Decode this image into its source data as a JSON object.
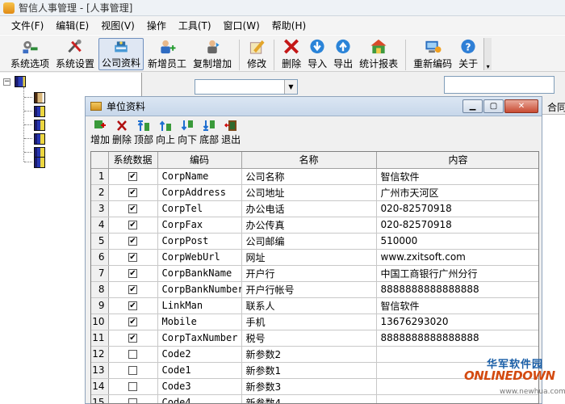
{
  "window": {
    "title": "智信人事管理 - [人事管理]"
  },
  "menu": [
    "文件(F)",
    "编辑(E)",
    "视图(V)",
    "操作",
    "工具(T)",
    "窗口(W)",
    "帮助(H)"
  ],
  "toolbar": [
    {
      "label": "系统选项",
      "icon": "options-icon"
    },
    {
      "label": "系统设置",
      "icon": "settings-icon"
    },
    {
      "label": "公司资料",
      "icon": "company-icon"
    },
    {
      "label": "新增员工",
      "icon": "add-employee-icon"
    },
    {
      "label": "复制增加",
      "icon": "copy-add-icon"
    },
    {
      "label": "修改",
      "icon": "edit-icon"
    },
    {
      "label": "删除",
      "icon": "delete-icon"
    },
    {
      "label": "导入",
      "icon": "import-icon"
    },
    {
      "label": "导出",
      "icon": "export-icon"
    },
    {
      "label": "统计报表",
      "icon": "report-icon"
    },
    {
      "label": "重新编码",
      "icon": "recode-icon"
    },
    {
      "label": "关于",
      "icon": "about-icon"
    }
  ],
  "right_panel": {
    "header": "合同"
  },
  "dialog": {
    "title": "单位资料",
    "toolbar": [
      {
        "label": "增加",
        "icon": "add-icon"
      },
      {
        "label": "删除",
        "icon": "delete-icon"
      },
      {
        "label": "顶部",
        "icon": "top-icon"
      },
      {
        "label": "向上",
        "icon": "up-icon"
      },
      {
        "label": "向下",
        "icon": "down-icon"
      },
      {
        "label": "底部",
        "icon": "bottom-icon"
      },
      {
        "label": "退出",
        "icon": "exit-icon"
      }
    ],
    "columns": [
      "系统数据",
      "编码",
      "名称",
      "内容"
    ],
    "rows": [
      {
        "n": "1",
        "sys": true,
        "code": "CorpName",
        "name": "公司名称",
        "content": "智信软件"
      },
      {
        "n": "2",
        "sys": true,
        "code": "CorpAddress",
        "name": "公司地址",
        "content": "广州市天河区"
      },
      {
        "n": "3",
        "sys": true,
        "code": "CorpTel",
        "name": "办公电话",
        "content": "020-82570918"
      },
      {
        "n": "4",
        "sys": true,
        "code": "CorpFax",
        "name": "办公传真",
        "content": "020-82570918"
      },
      {
        "n": "5",
        "sys": true,
        "code": "CorpPost",
        "name": "公司邮编",
        "content": "510000"
      },
      {
        "n": "6",
        "sys": true,
        "code": "CorpWebUrl",
        "name": "网址",
        "content": "www.zxitsoft.com"
      },
      {
        "n": "7",
        "sys": true,
        "code": "CorpBankName",
        "name": "开户行",
        "content": "中国工商银行广州分行"
      },
      {
        "n": "8",
        "sys": true,
        "code": "CorpBankNumber",
        "name": "开户行帐号",
        "content": "8888888888888888"
      },
      {
        "n": "9",
        "sys": true,
        "code": "LinkMan",
        "name": "联系人",
        "content": "智信软件"
      },
      {
        "n": "10",
        "sys": true,
        "code": "Mobile",
        "name": "手机",
        "content": "13676293020"
      },
      {
        "n": "11",
        "sys": true,
        "code": "CorpTaxNumber",
        "name": "税号",
        "content": "8888888888888888"
      },
      {
        "n": "12",
        "sys": false,
        "code": "Code2",
        "name": "新参数2",
        "content": ""
      },
      {
        "n": "13",
        "sys": false,
        "code": "Code1",
        "name": "新参数1",
        "content": ""
      },
      {
        "n": "14",
        "sys": false,
        "code": "Code3",
        "name": "新参数3",
        "content": ""
      },
      {
        "n": "15",
        "sys": false,
        "code": "Code4",
        "name": "新参数4",
        "content": ""
      }
    ]
  },
  "watermark": {
    "cn": "华军软件园",
    "en": "ONLINEDOWN",
    "url": "www.newhua.com"
  }
}
